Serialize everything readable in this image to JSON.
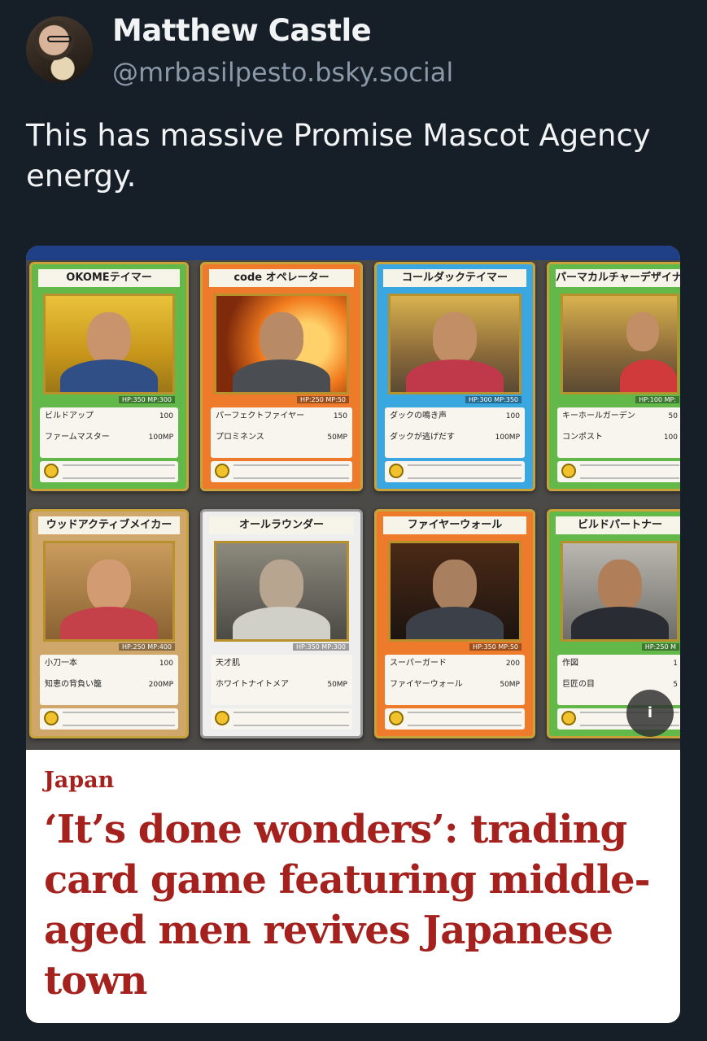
{
  "post": {
    "display_name": "Matthew Castle",
    "handle": "@mrbasilpesto.bsky.social",
    "text": "This has massive Promise Mascot Agency energy."
  },
  "embed": {
    "kicker": "Japan",
    "headline": "‘It’s done wonders’: trading card game featuring middle-aged men revives Japanese town",
    "alt_badge": "i"
  },
  "cards": [
    {
      "title": "OKOMEテイマー",
      "stats": "HP:350 MP:300",
      "move1": "ビルドアップ",
      "move1_val": "100",
      "move2": "ファームマスター",
      "move2_val": "100MP"
    },
    {
      "title": "code オペレーター",
      "stats": "HP:250 MP:50",
      "move1": "パーフェクトファイヤー",
      "move1_val": "150",
      "move2": "プロミネンス",
      "move2_val": "50MP"
    },
    {
      "title": "コールダックテイマー",
      "stats": "HP:300 MP:350",
      "move1": "ダックの鳴き声",
      "move1_val": "100",
      "move2": "ダックが逃げだす",
      "move2_val": "100MP"
    },
    {
      "title": "パーマカルチャーデザイナー",
      "stats": "HP:100 MP:",
      "move1": "キーホールガーデン",
      "move1_val": "50",
      "move2": "コンポスト",
      "move2_val": "100"
    },
    {
      "title": "ウッドアクティブメイカー",
      "stats": "HP:250 MP:400",
      "move1": "小刀一本",
      "move1_val": "100",
      "move2": "知恵の背負い籠",
      "move2_val": "200MP"
    },
    {
      "title": "オールラウンダー",
      "stats": "HP:350 MP:300",
      "move1": "天才肌",
      "move1_val": "",
      "move2": "ホワイトナイトメア",
      "move2_val": "50MP"
    },
    {
      "title": "ファイヤーウォール",
      "stats": "HP:350 MP:50",
      "move1": "スーパーガード",
      "move1_val": "200",
      "move2": "ファイヤーウォール",
      "move2_val": "50MP"
    },
    {
      "title": "ビルドパートナー",
      "stats": "HP:250 M",
      "move1": "作図",
      "move1_val": "1",
      "move2": "巨匠の目",
      "move2_val": "5"
    }
  ],
  "colors": {
    "background": "#161e27",
    "headline": "#a4211d",
    "handle": "#8a98a8"
  }
}
